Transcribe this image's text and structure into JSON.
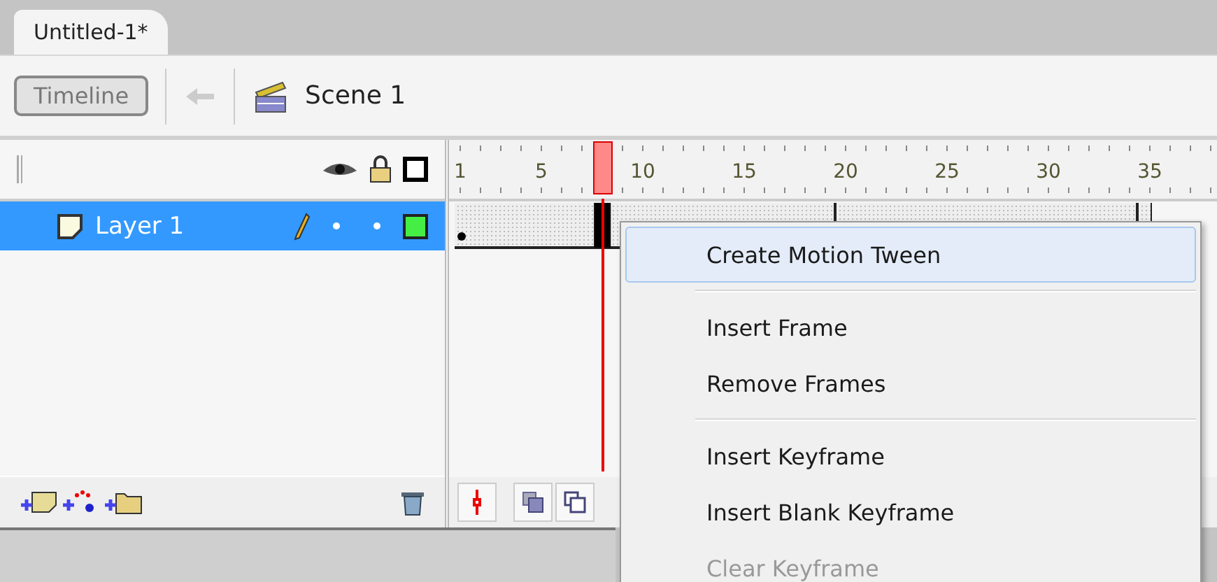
{
  "document_tab": {
    "title": "Untitled-1*",
    "selected": true
  },
  "toolbar": {
    "timeline_button": "Timeline",
    "scene": "Scene 1"
  },
  "ruler": {
    "labels": [
      "1",
      "5",
      "10",
      "15",
      "20",
      "25",
      "30",
      "35"
    ],
    "playhead": {
      "level": 0.2
    }
  },
  "layers": [
    {
      "name": "Layer 1",
      "selected": true,
      "color": "#44ee44"
    }
  ],
  "context_menu": {
    "items": [
      {
        "kind": "item",
        "label": "Create Motion Tween",
        "selected": true,
        "disabled": false
      },
      {
        "kind": "separator"
      },
      {
        "kind": "item",
        "label": "Insert Frame",
        "selected": false,
        "disabled": false
      },
      {
        "kind": "item",
        "label": "Remove Frames",
        "selected": false,
        "disabled": false
      },
      {
        "kind": "separator"
      },
      {
        "kind": "item",
        "label": "Insert Keyframe",
        "selected": false,
        "disabled": false
      },
      {
        "kind": "item",
        "label": "Insert Blank Keyframe",
        "selected": false,
        "disabled": false
      },
      {
        "kind": "item",
        "label": "Clear Keyframe",
        "selected": false,
        "disabled": true
      }
    ]
  }
}
